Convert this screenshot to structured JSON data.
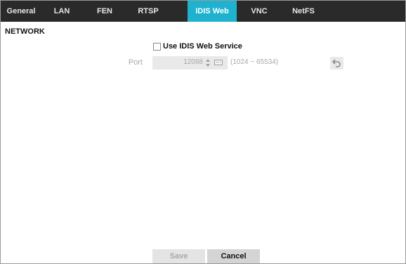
{
  "tabs": [
    {
      "label": "General",
      "active": false
    },
    {
      "label": "LAN",
      "active": false
    },
    {
      "label": "FEN",
      "active": false
    },
    {
      "label": "RTSP",
      "active": false
    },
    {
      "label": "IDIS Web",
      "active": true
    },
    {
      "label": "VNC",
      "active": false
    },
    {
      "label": "NetFS",
      "active": false
    }
  ],
  "colors": {
    "active_tab": "#1fb2cf",
    "tab_bar": "#2a2a2a"
  },
  "section": {
    "title": "NETWORK"
  },
  "web_service": {
    "checkbox_label": "Use IDIS Web Service",
    "checked": false
  },
  "port": {
    "label": "Port",
    "value": "12088",
    "range": "(1024 ~ 65534)"
  },
  "icons": {
    "spinner": "spinner-icon",
    "keyboard": "keyboard-icon",
    "reset": "undo-icon"
  },
  "buttons": {
    "save": "Save",
    "cancel": "Cancel"
  }
}
